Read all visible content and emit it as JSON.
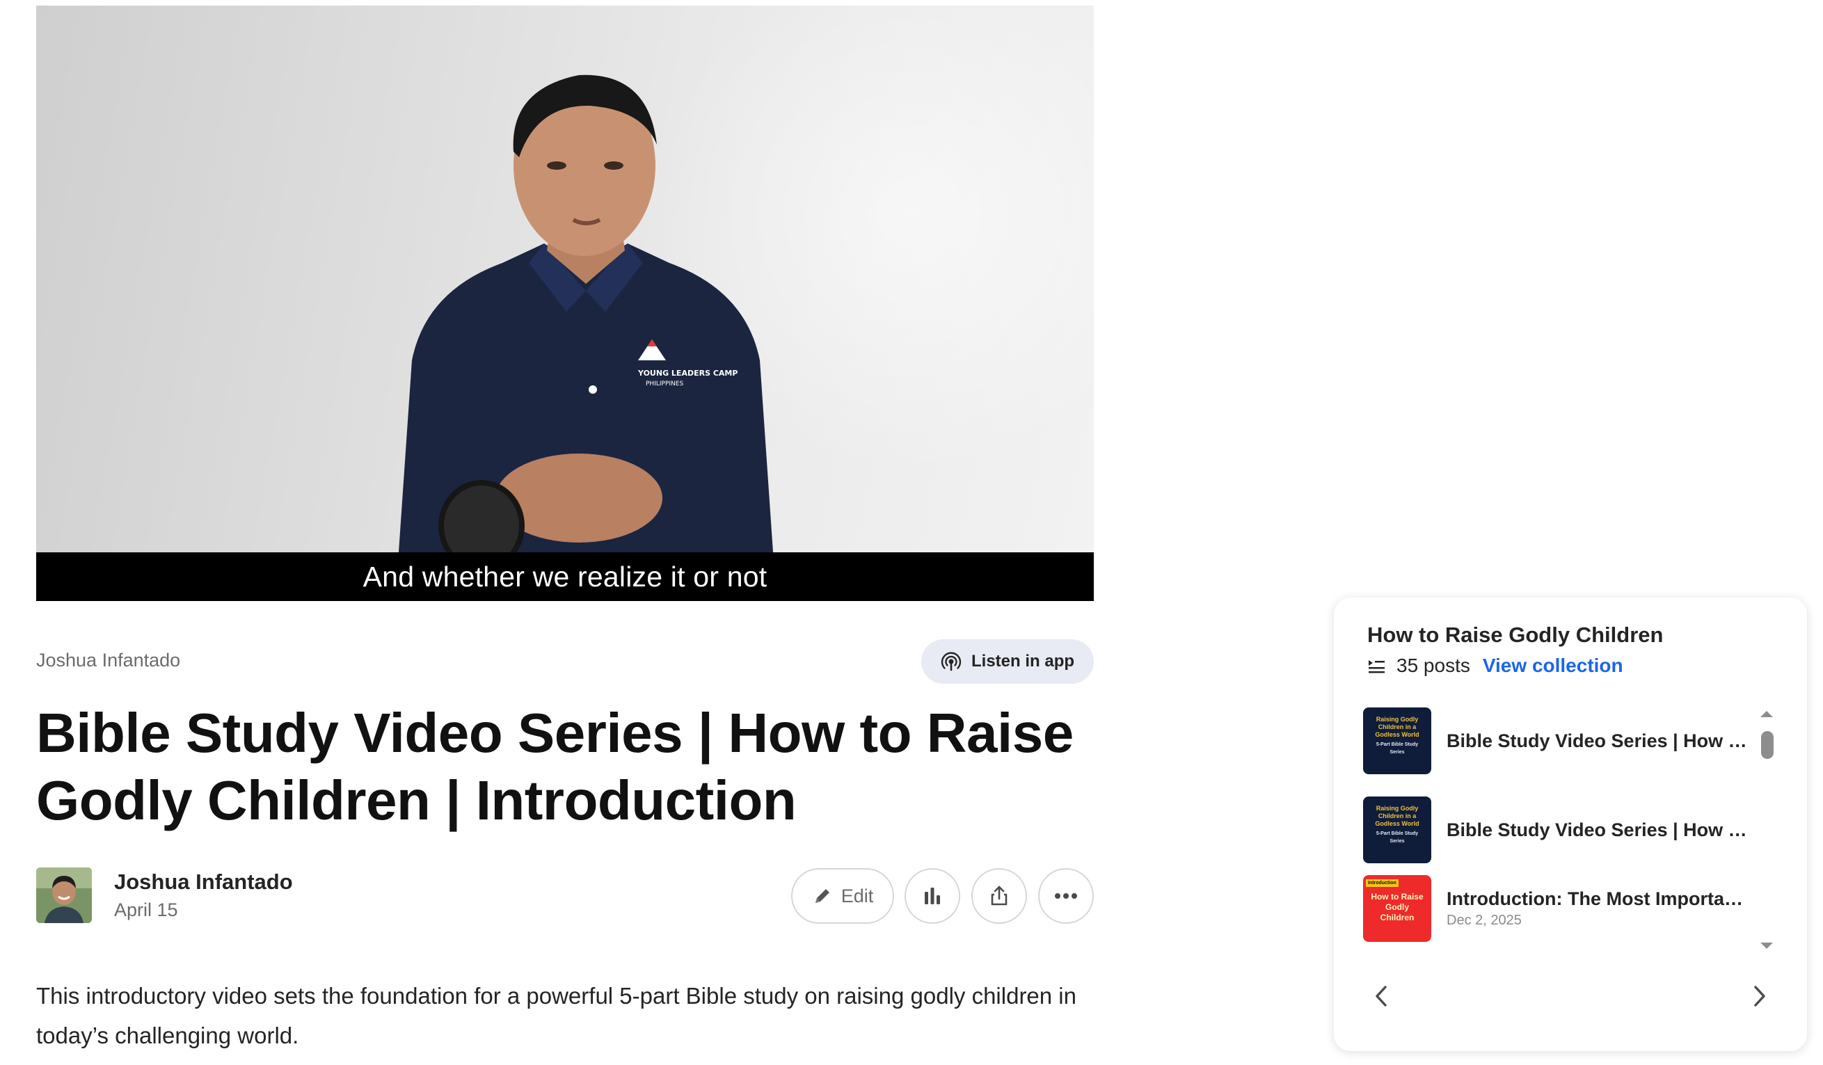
{
  "video": {
    "caption": "And whether we realize it or not",
    "shirt_logo_line1": "YOUNG LEADERS CAMP",
    "shirt_logo_line2": "PHILIPPINES"
  },
  "article": {
    "author_small": "Joshua Infantado",
    "listen_label": "Listen in app",
    "title": "Bible Study Video Series | How to Raise Godly Children | Introduction",
    "author_name": "Joshua Infantado",
    "date": "April 15",
    "edit_label": "Edit",
    "body": "This introductory video sets the foundation for a powerful 5-part Bible study on raising godly children in today’s challenging world."
  },
  "collection": {
    "title": "How to Raise Godly Children",
    "count": "35 posts",
    "view_label": "View collection",
    "items": [
      {
        "title": "Bible Study Video Series | How to Raise Godly Children | Introduction",
        "thumb_line1": "Raising Godly Children in a Godless World",
        "thumb_line2": "5-Part Bible Study Series"
      },
      {
        "title": "Bible Study Video Series | How to Raise Godly Children",
        "thumb_line1": "Raising Godly Children in a Godless World",
        "thumb_line2": "5-Part Bible Study Series"
      },
      {
        "title": "Introduction: The Most Important Job You'll Ever Have",
        "date": "Dec 2, 2025",
        "thumb_tag": "Introduction",
        "thumb_line1": "How to Raise Godly Children"
      }
    ]
  },
  "colors": {
    "accent": "#1a66e8",
    "listen_bg": "#e8ebf3",
    "shirt": "#1b2540"
  }
}
